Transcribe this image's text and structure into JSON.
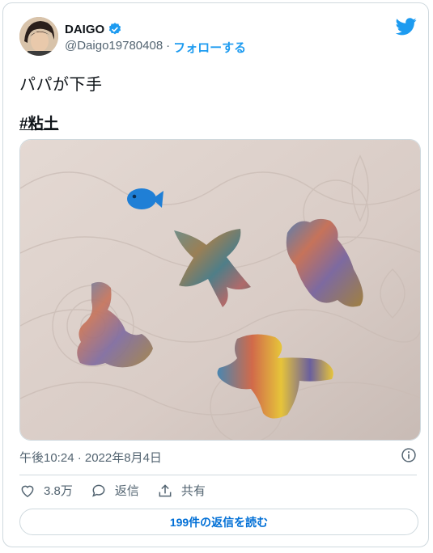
{
  "author": {
    "name": "DAIGO",
    "handle": "@Daigo19780408",
    "separator": "·",
    "follow_label": "フォローする"
  },
  "tweet": {
    "text": "パパが下手",
    "hashtag": "#粘土"
  },
  "timestamp": "午後10:24 · 2022年8月4日",
  "actions": {
    "like_count": "3.8万",
    "reply_label": "返信",
    "share_label": "共有"
  },
  "read_replies_label": "199件の返信を読む",
  "colors": {
    "accent": "#1d9bf0",
    "text": "#0f1419",
    "muted": "#536471",
    "border": "#cfd9de"
  },
  "icons": [
    "verified-badge-icon",
    "twitter-bird-icon",
    "info-icon",
    "heart-icon",
    "reply-icon",
    "share-icon"
  ]
}
